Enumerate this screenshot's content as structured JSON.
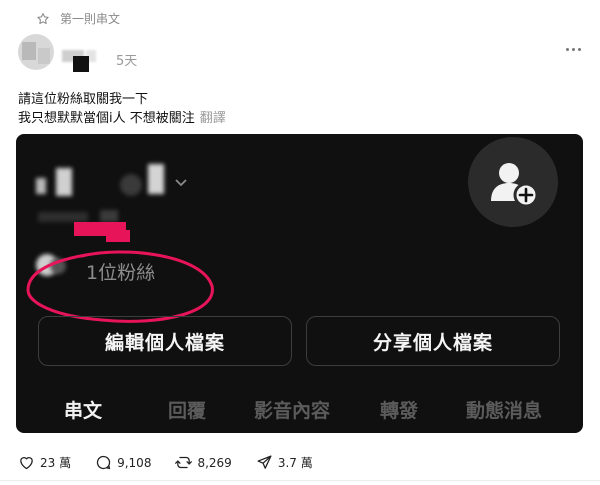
{
  "pinned": {
    "label": "第一則串文"
  },
  "author": {
    "time": "5天"
  },
  "post": {
    "line1": "請這位粉絲取關我一下",
    "line2": "我只想默默當個i人 不想被關注",
    "translate": "翻譯"
  },
  "card": {
    "followers": "1位粉絲",
    "edit_button": "編輯個人檔案",
    "share_button": "分享個人檔案",
    "tabs": [
      "串文",
      "回覆",
      "影音內容",
      "轉發",
      "動態消息"
    ],
    "active_tab": "串文",
    "annotation_color": "#e8145a"
  },
  "actions": {
    "likes": "23 萬",
    "comments": "9,108",
    "reposts": "8,269",
    "shares": "3.7 萬"
  },
  "icons": [
    "star-icon",
    "more-icon",
    "add-person-icon",
    "chevron-down-icon",
    "heart-icon",
    "comment-icon",
    "repost-icon",
    "share-icon"
  ]
}
